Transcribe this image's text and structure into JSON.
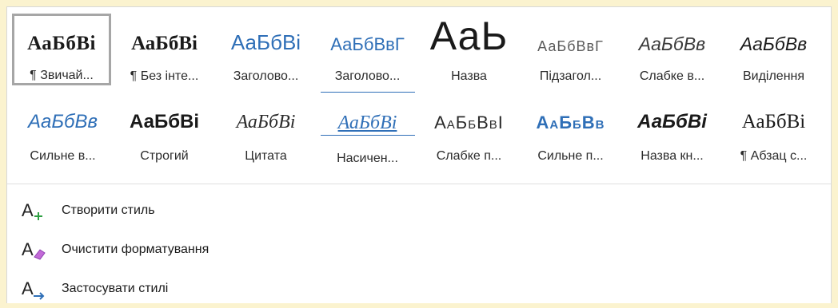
{
  "styles_row1": [
    {
      "sample": "АаБбВі",
      "label": "¶ Звичай...",
      "selected": true
    },
    {
      "sample": "АаБбВі",
      "label": "¶ Без інте..."
    },
    {
      "sample": "АаБбВі",
      "label": "Заголово..."
    },
    {
      "sample": "АаБбВвГ",
      "label": "Заголово..."
    },
    {
      "sample": "АаЬ",
      "label": "Назва"
    },
    {
      "sample": "АаБбВвГ",
      "label": "Підзагол..."
    },
    {
      "sample": "АаБбВв",
      "label": "Слабке в..."
    },
    {
      "sample": "АаБбВв",
      "label": "Виділення"
    }
  ],
  "styles_row2": [
    {
      "sample": "АаБбВв",
      "label": "Сильне в..."
    },
    {
      "sample": "АаБбВі",
      "label": "Строгий"
    },
    {
      "sample": "АаБбВі",
      "label": "Цитата"
    },
    {
      "sample": "АаБбВі",
      "label": "Насичен..."
    },
    {
      "sample": "АаБбВвІ",
      "label": "Слабке п..."
    },
    {
      "sample": "АаБбВв",
      "label": "Сильне п..."
    },
    {
      "sample": "АаБбВі",
      "label": "Назва кн..."
    },
    {
      "sample": "АаБбВі",
      "label": "¶ Абзац с..."
    }
  ],
  "menu": {
    "create_style": "Створити стиль",
    "clear_formatting": "Очистити форматування",
    "apply_styles": "Застосувати стилі"
  },
  "colors": {
    "accent": "#2f6fb7",
    "background": "#fbf3cf",
    "selected_border": "#a6a6a6"
  }
}
